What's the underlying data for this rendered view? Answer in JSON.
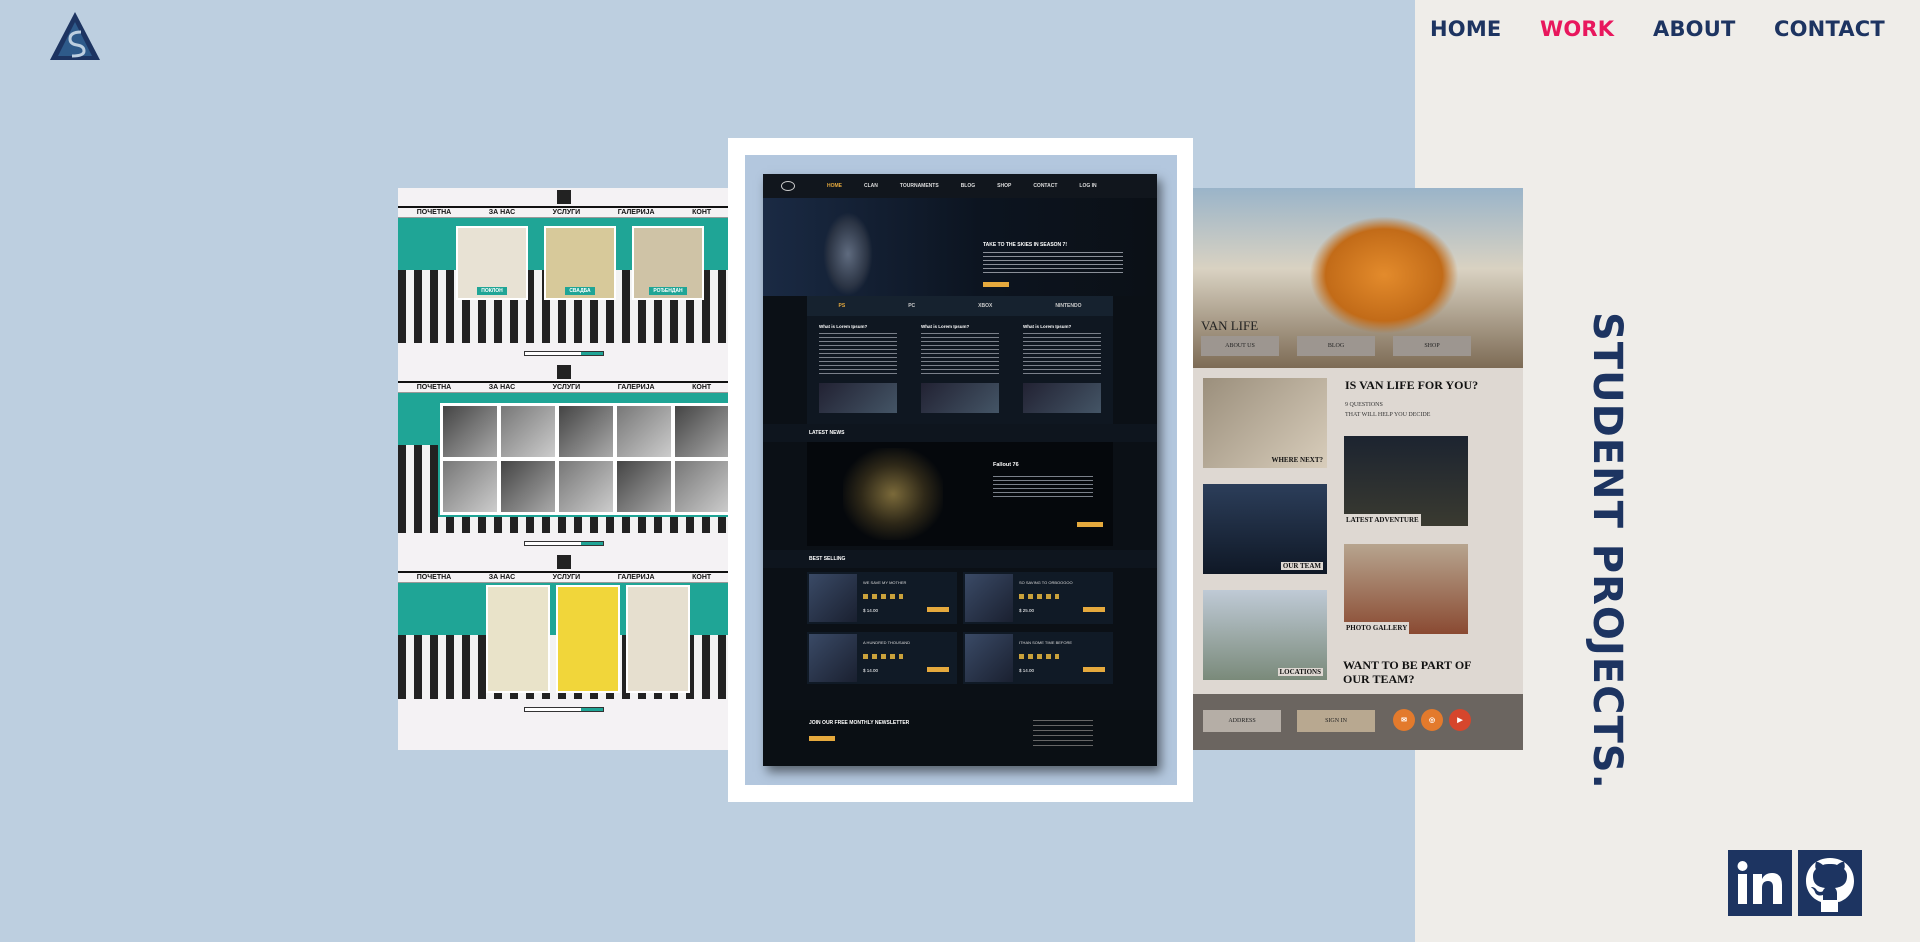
{
  "nav": {
    "home": "HOME",
    "work": "WORK",
    "about": "ABOUT",
    "contact": "CONTACT",
    "active": "WORK"
  },
  "section_title": "STUDENT PROJECTS.",
  "colors": {
    "background": "#bdcfe0",
    "panel": "#efede9",
    "navy": "#1d3461",
    "accent": "#e8175d"
  },
  "social": [
    {
      "name": "linkedin-icon"
    },
    {
      "name": "github-icon"
    }
  ],
  "preview_left": {
    "nav": [
      "ПОЧЕТНА",
      "ЗА НАС",
      "УСЛУГИ",
      "ГАЛЕРИЈА",
      "КОНТ"
    ],
    "cards": [
      "ПОКЛОН",
      "СВАДБА",
      "РОЂЕНДАН"
    ]
  },
  "preview_center": {
    "nav": [
      "HOME",
      "CLAN",
      "TOURNAMENTS",
      "BLOG",
      "SHOP",
      "CONTACT",
      "LOG IN"
    ],
    "hero_title": "TAKE TO THE SKIES IN SEASON 7!",
    "tabs": [
      "PS",
      "PC",
      "XBOX",
      "NINTENDO"
    ],
    "column_heading": "What is Lorem Ipsum?",
    "latest_news": "LATEST NEWS",
    "news_title": "Fallout 76",
    "best_selling": "BEST SELLING",
    "items": [
      {
        "name": "WE SAVE MY MOTHER",
        "price": "$ 14.00"
      },
      {
        "name": "SO SAVING TO ORBOOGOO",
        "price": "$ 25.00"
      },
      {
        "name": "A HUNDRED THOUSAND",
        "price": "$ 14.00"
      },
      {
        "name": "ITHAN SOME TIME BEFORE",
        "price": "$ 14.00"
      }
    ],
    "newsletter": "JOIN OUR FREE MONTHLY NEWSLETTER"
  },
  "preview_right": {
    "title": "VAN LIFE",
    "buttons": [
      "ABOUT US",
      "BLOG",
      "SHOP"
    ],
    "question": "IS VAN LIFE FOR YOU?",
    "questions_small": "9 QUESTIONS",
    "questions_sub": "THAT WILL HELP YOU DECIDE",
    "captions": [
      "WHERE NEXT?",
      "OUR TEAM",
      "LOCATIONS",
      "LATEST ADVENTURE",
      "PHOTO GALLERY"
    ],
    "cta": "WANT TO BE PART OF OUR TEAM?",
    "footer_buttons": [
      "ADDRESS",
      "SIGN IN"
    ]
  }
}
